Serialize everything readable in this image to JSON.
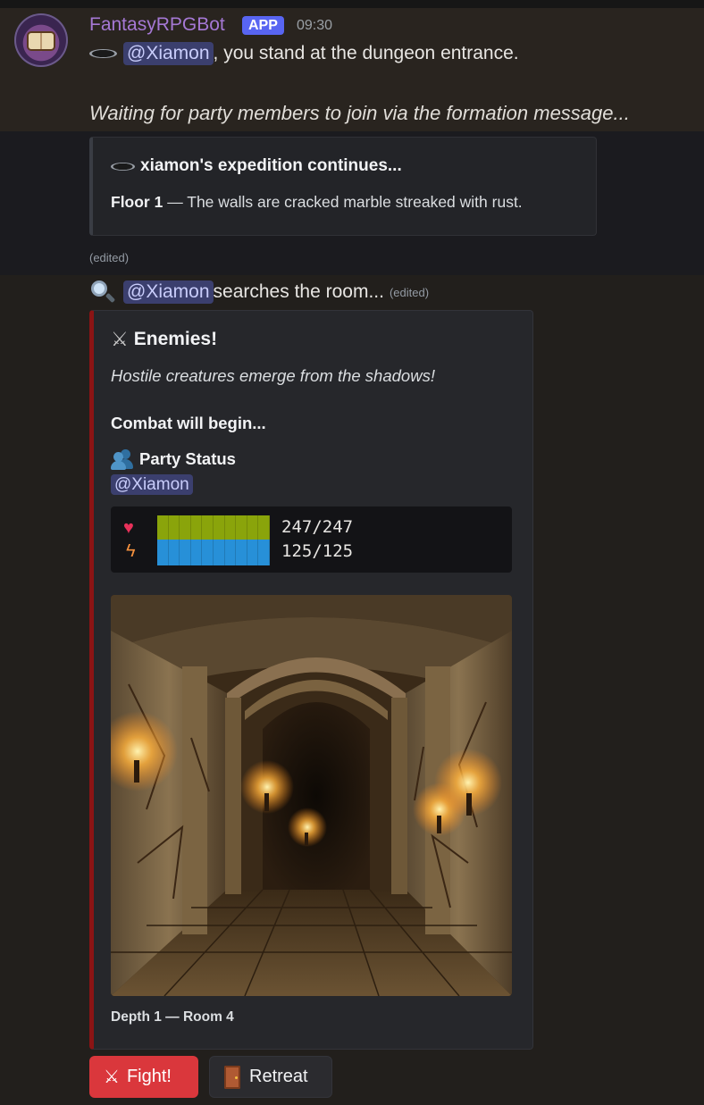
{
  "message": {
    "username": "FantasyRPGBot",
    "badge": "APP",
    "timestamp": "09:30",
    "mention": "@Xiamon",
    "line1_rest": ", you stand at the dungeon entrance.",
    "line2": "Waiting for party members to join via the formation message...",
    "embed": {
      "title": "xiamon's expedition continues...",
      "floor_label": "Floor 1",
      "floor_text": " — The walls are cracked marble streaked with rust."
    },
    "edited": "(edited)"
  },
  "message2": {
    "mention": "@Xiamon",
    "text": " searches the room...",
    "edited": "(edited)",
    "embed": {
      "title": "Enemies!",
      "subtitle": "Hostile creatures emerge from the shadows!",
      "combat": "Combat will begin...",
      "party_label": "Party Status",
      "party_mention": "@Xiamon",
      "hp": "247/247",
      "mp": "125/125",
      "footer": "Depth 1 — Room 4"
    }
  },
  "buttons": {
    "fight": "Fight!",
    "retreat": "Retreat"
  },
  "colors": {
    "accent_embed": "#8b1414",
    "hp_bar": "#8aa40b",
    "mp_bar": "#2790d8",
    "fight_button": "#da373c"
  }
}
